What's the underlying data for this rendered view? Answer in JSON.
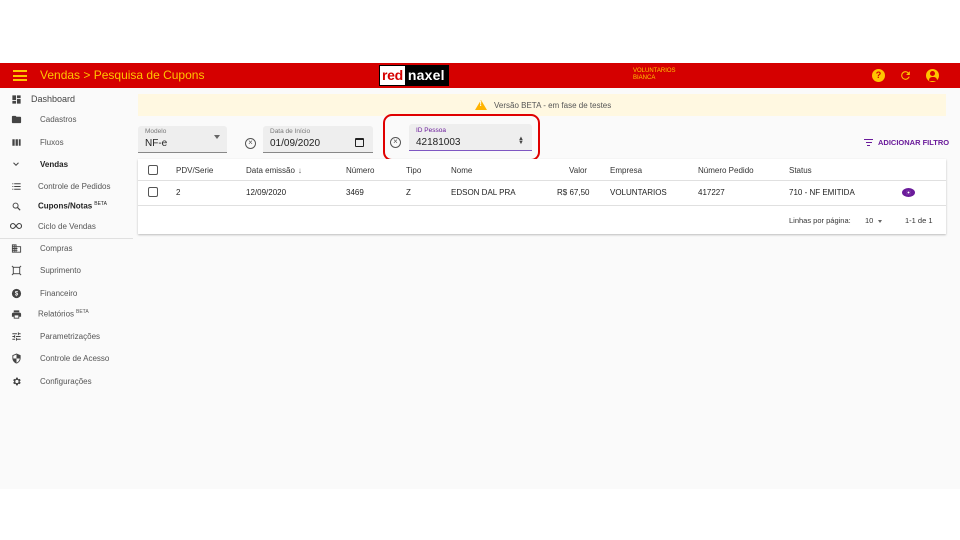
{
  "header": {
    "title": "Vendas > Pesquisa de Cupons",
    "logo": {
      "part1": "red",
      "part2": "naxel"
    },
    "org": {
      "line1": "VOLUNTARIOS",
      "line2": "BIANCA"
    },
    "icons": [
      "help-icon",
      "refresh-icon",
      "account-icon"
    ],
    "help_glyph": "?"
  },
  "colors": {
    "topbar": "#d50000",
    "accent": "#ffc400",
    "primary": "#6a1b9a",
    "banner": "#fff8e1",
    "highlight": "#e00000"
  },
  "sidebar": {
    "dashboard": "Dashboard",
    "cadastros": "Cadastros",
    "fluxos": "Fluxos",
    "vendas": "Vendas",
    "controle_pedidos": "Controle de Pedidos",
    "cupons_notas": "Cupons/Notas",
    "cupons_beta": "BETA",
    "ciclo_vendas": "Ciclo de Vendas",
    "compras": "Compras",
    "suprimento": "Suprimento",
    "financeiro": "Financeiro",
    "relatorios": "Relatórios",
    "relatorios_beta": "BETA",
    "parametrizacoes": "Parametrizações",
    "controle_acesso": "Controle de Acesso",
    "configuracoes": "Configurações"
  },
  "banner": {
    "text": "Versão BETA - em fase de testes"
  },
  "filters": {
    "modelo": {
      "label": "Modelo",
      "value": "NF-e"
    },
    "data_inicio": {
      "label": "Data de Início",
      "value": "01/09/2020"
    },
    "id_pessoa": {
      "label": "ID Pessoa",
      "value": "42181003"
    },
    "add_filter_label": "ADICIONAR FILTRO",
    "clear_glyph": "×"
  },
  "table": {
    "columns": {
      "pdv_serie": "PDV/Serie",
      "data_emissao": "Data emissão",
      "numero": "Número",
      "tipo": "Tipo",
      "nome": "Nome",
      "valor": "Valor",
      "empresa": "Empresa",
      "numero_pedido": "Número Pedido",
      "status": "Status"
    },
    "sort_glyph": "↓",
    "rows": [
      {
        "pdv_serie": "2",
        "data_emissao": "12/09/2020",
        "numero": "3469",
        "tipo": "Z",
        "nome": "EDSON DAL PRA",
        "valor": "R$ 67,50",
        "empresa": "VOLUNTARIOS",
        "numero_pedido": "417227",
        "status": "710 - NF EMITIDA"
      }
    ],
    "pagination": {
      "rows_per_page_label": "Linhas por página:",
      "rows_per_page": "10",
      "range": "1-1 de 1"
    }
  }
}
